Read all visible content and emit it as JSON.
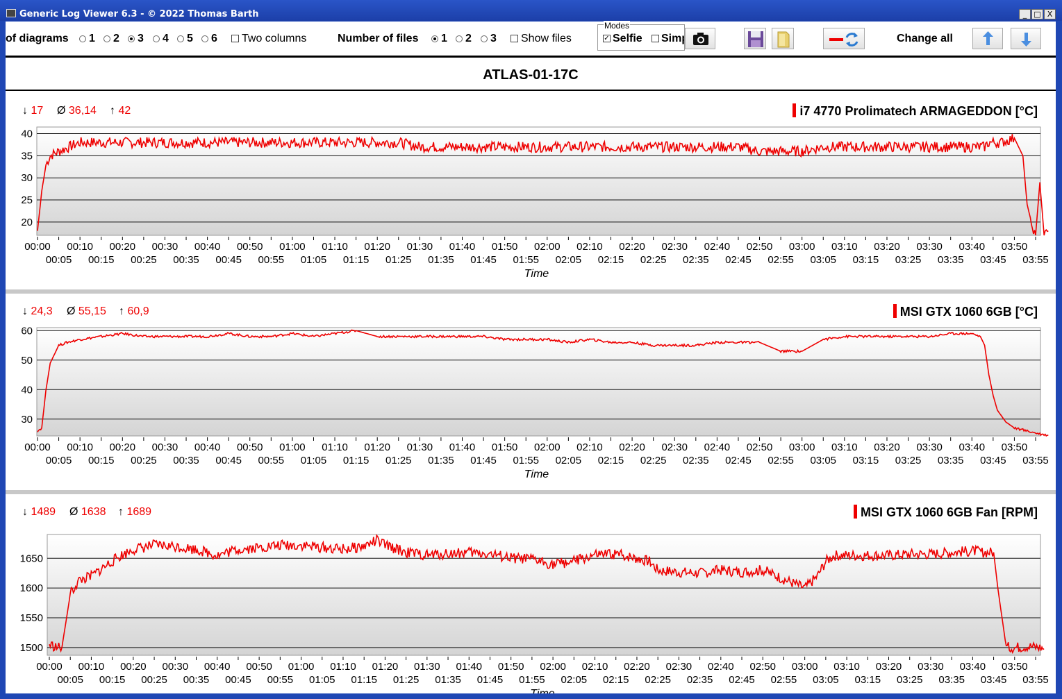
{
  "window": {
    "title": "Generic Log Viewer 6.3 - © 2022 Thomas Barth",
    "btn_min": "_",
    "btn_max": "□",
    "btn_close": "X"
  },
  "toolbar": {
    "diagrams_label": "of diagrams",
    "diagram_options": [
      "1",
      "2",
      "3",
      "4",
      "5",
      "6"
    ],
    "diagrams_selected": "3",
    "two_columns_label": "Two columns",
    "files_label": "Number of files",
    "file_options": [
      "1",
      "2",
      "3"
    ],
    "files_selected": "1",
    "show_files_label": "Show files",
    "modes_label": "Modes",
    "selfie_label": "Selfie",
    "simple_label": "Simp",
    "selfie_checked": true,
    "change_all_label": "Change all",
    "icons": [
      "camera-icon",
      "save-icon",
      "folder-icon",
      "line-color-icon",
      "refresh-icon",
      "arrow-up-icon",
      "arrow-down-icon"
    ]
  },
  "header_title": "ATLAS-01-17C",
  "colors": {
    "series": "#ee0000",
    "accent": "#1f47b4",
    "text": "#000000"
  },
  "chart_data": [
    {
      "type": "line",
      "title": "i7 4770 Prolimatech ARMAGEDDON [°C]",
      "stats": {
        "min": "17",
        "avg": "36,14",
        "max": "42"
      },
      "xlabel": "Time",
      "ylabel": "",
      "ylim": [
        17,
        41.5
      ],
      "yticks": [
        40,
        35,
        30,
        25,
        20
      ],
      "x_ticks_top": [
        "00:00",
        "00:10",
        "00:20",
        "00:30",
        "00:40",
        "00:50",
        "01:00",
        "01:10",
        "01:20",
        "01:30",
        "01:40",
        "01:50",
        "02:00",
        "02:10",
        "02:20",
        "02:30",
        "02:40",
        "02:50",
        "03:00",
        "03:10",
        "03:20",
        "03:30",
        "03:40",
        "03:50"
      ],
      "x_ticks_bottom": [
        "00:05",
        "00:15",
        "00:25",
        "00:35",
        "00:45",
        "00:55",
        "01:05",
        "01:15",
        "01:25",
        "01:35",
        "01:45",
        "01:55",
        "02:05",
        "02:15",
        "02:25",
        "02:35",
        "02:45",
        "02:55",
        "03:05",
        "03:15",
        "03:25",
        "03:35",
        "03:45",
        "03:55"
      ],
      "x_minutes": [
        0,
        1,
        2,
        3,
        5,
        10,
        15,
        20,
        25,
        30,
        35,
        40,
        45,
        50,
        55,
        60,
        65,
        70,
        75,
        80,
        85,
        90,
        95,
        100,
        105,
        110,
        115,
        120,
        125,
        130,
        135,
        140,
        145,
        150,
        155,
        160,
        165,
        170,
        175,
        180,
        185,
        190,
        195,
        200,
        205,
        210,
        215,
        220,
        222,
        223,
        224,
        225,
        227,
        230,
        232,
        233,
        234,
        235,
        236,
        237,
        238
      ],
      "values": [
        18,
        27,
        33,
        35,
        36,
        38,
        38,
        38,
        38,
        38,
        38,
        38,
        38,
        38,
        38,
        38,
        38,
        38,
        38,
        38,
        38,
        37,
        37,
        37,
        37,
        37,
        37,
        37,
        37,
        37,
        37,
        37,
        37,
        37,
        37,
        37,
        37,
        36,
        36,
        36,
        37,
        37,
        37,
        37,
        37,
        37,
        37,
        37,
        37,
        37,
        38,
        38,
        38,
        39,
        35,
        24,
        20,
        17,
        29,
        17,
        18
      ]
    },
    {
      "type": "line",
      "title": "MSI GTX 1060 6GB  [°C]",
      "stats": {
        "min": "24,3",
        "avg": "55,15",
        "max": "60,9"
      },
      "xlabel": "Time",
      "ylabel": "",
      "ylim": [
        24.3,
        61
      ],
      "yticks": [
        60,
        50,
        40,
        30
      ],
      "x_ticks_top": [
        "00:00",
        "00:10",
        "00:20",
        "00:30",
        "00:40",
        "00:50",
        "01:00",
        "01:10",
        "01:20",
        "01:30",
        "01:40",
        "01:50",
        "02:00",
        "02:10",
        "02:20",
        "02:30",
        "02:40",
        "02:50",
        "03:00",
        "03:10",
        "03:20",
        "03:30",
        "03:40",
        "03:50"
      ],
      "x_ticks_bottom": [
        "00:05",
        "00:15",
        "00:25",
        "00:35",
        "00:45",
        "00:55",
        "01:05",
        "01:15",
        "01:25",
        "01:35",
        "01:45",
        "01:55",
        "02:05",
        "02:15",
        "02:25",
        "02:35",
        "02:45",
        "02:55",
        "03:05",
        "03:15",
        "03:25",
        "03:35",
        "03:45",
        "03:55"
      ],
      "x_minutes": [
        0,
        1,
        2,
        3,
        4,
        5,
        7,
        10,
        15,
        20,
        25,
        30,
        35,
        40,
        45,
        50,
        55,
        60,
        65,
        70,
        75,
        80,
        85,
        90,
        95,
        100,
        105,
        110,
        115,
        120,
        125,
        130,
        135,
        140,
        145,
        150,
        155,
        160,
        165,
        170,
        175,
        180,
        185,
        190,
        195,
        200,
        205,
        210,
        215,
        220,
        222,
        223,
        224,
        225,
        226,
        228,
        230,
        233,
        236,
        238
      ],
      "values": [
        26,
        27,
        40,
        49,
        52,
        55,
        56,
        57,
        58,
        59,
        58,
        58,
        58,
        58,
        59,
        58,
        58,
        59,
        58,
        59,
        60,
        58,
        58,
        58,
        58,
        58,
        58,
        57,
        57,
        57,
        56,
        57,
        56,
        56,
        55,
        55,
        55,
        56,
        56,
        56,
        53,
        53,
        57,
        58,
        58,
        58,
        58,
        58,
        59,
        59,
        58,
        55,
        45,
        38,
        33,
        29,
        27,
        26,
        25,
        24.5
      ]
    },
    {
      "type": "line",
      "title": "MSI GTX 1060 6GB Fan [RPM]",
      "stats": {
        "min": "1489",
        "avg": "1638",
        "max": "1689"
      },
      "xlabel": "Time",
      "ylabel": "",
      "ylim": [
        1487,
        1690
      ],
      "yticks": [
        1650,
        1600,
        1550,
        1500
      ],
      "x_ticks_top": [
        "00:00",
        "00:10",
        "00:20",
        "00:30",
        "00:40",
        "00:50",
        "01:00",
        "01:10",
        "01:20",
        "01:30",
        "01:40",
        "01:50",
        "02:00",
        "02:10",
        "02:20",
        "02:30",
        "02:40",
        "02:50",
        "03:00",
        "03:10",
        "03:20",
        "03:30",
        "03:40",
        "03:50"
      ],
      "x_ticks_bottom": [
        "00:05",
        "00:15",
        "00:25",
        "00:35",
        "00:45",
        "00:55",
        "01:05",
        "01:15",
        "01:25",
        "01:35",
        "01:45",
        "01:55",
        "02:05",
        "02:15",
        "02:25",
        "02:35",
        "02:45",
        "02:55",
        "03:05",
        "03:15",
        "03:25",
        "03:35",
        "03:45",
        "03:55"
      ],
      "x_minutes": [
        0,
        2,
        3,
        4,
        5,
        7,
        10,
        13,
        16,
        20,
        25,
        30,
        35,
        40,
        45,
        50,
        55,
        60,
        65,
        70,
        75,
        78,
        80,
        85,
        90,
        95,
        100,
        105,
        110,
        115,
        120,
        125,
        130,
        135,
        140,
        143,
        145,
        150,
        155,
        160,
        165,
        170,
        175,
        180,
        183,
        185,
        187,
        190,
        195,
        200,
        205,
        210,
        215,
        220,
        223,
        225,
        226,
        228,
        230,
        233,
        236,
        237
      ],
      "values": [
        1505,
        1500,
        1500,
        1545,
        1590,
        1612,
        1620,
        1635,
        1650,
        1665,
        1672,
        1670,
        1665,
        1655,
        1665,
        1668,
        1672,
        1672,
        1668,
        1665,
        1670,
        1680,
        1672,
        1660,
        1655,
        1658,
        1660,
        1657,
        1650,
        1648,
        1640,
        1645,
        1655,
        1657,
        1650,
        1645,
        1630,
        1627,
        1625,
        1630,
        1627,
        1630,
        1615,
        1600,
        1620,
        1645,
        1655,
        1655,
        1655,
        1655,
        1657,
        1657,
        1660,
        1662,
        1660,
        1660,
        1600,
        1500,
        1500,
        1502,
        1500,
        1498
      ]
    }
  ]
}
